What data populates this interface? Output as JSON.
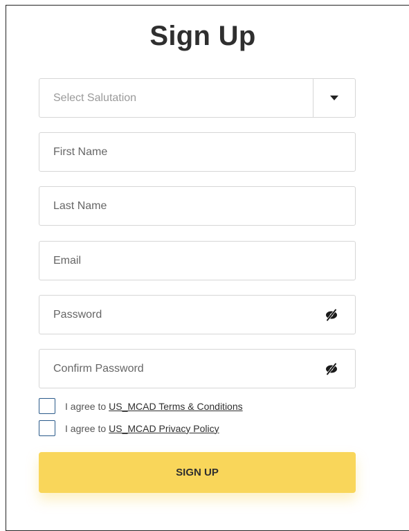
{
  "page": {
    "title": "Sign Up"
  },
  "form": {
    "salutation": {
      "placeholder": "Select Salutation",
      "icon": "chevron-down-icon"
    },
    "first_name": {
      "placeholder": "First Name"
    },
    "last_name": {
      "placeholder": "Last Name"
    },
    "email": {
      "placeholder": "Email"
    },
    "password": {
      "placeholder": "Password",
      "icon": "eye-off-icon"
    },
    "confirm_password": {
      "placeholder": "Confirm Password",
      "icon": "eye-off-icon"
    },
    "terms": {
      "prefix": "I agree to",
      "link": "US_MCAD Terms & Conditions",
      "checked": false
    },
    "privacy": {
      "prefix": "I agree to",
      "link": "US_MCAD Privacy Policy",
      "checked": false
    },
    "submit_label": "SIGN UP"
  },
  "colors": {
    "accent": "#f9d65a",
    "checkbox_border": "#2a5a8a",
    "field_border": "#d6d6d6"
  }
}
